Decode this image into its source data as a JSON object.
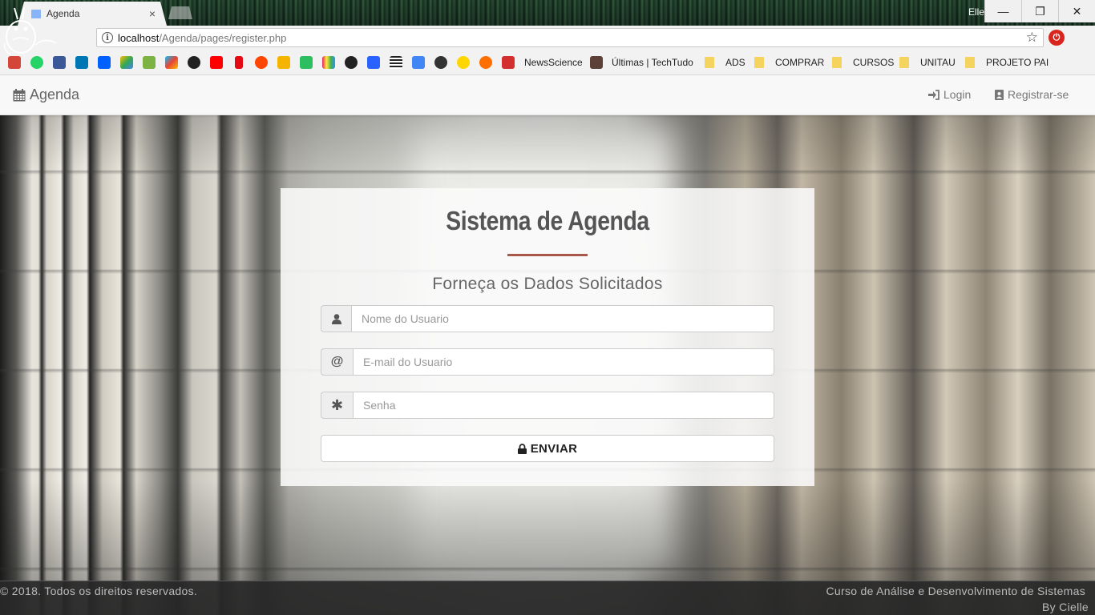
{
  "browser": {
    "tab_title": "Agenda",
    "tab_close": "×",
    "profile_name": "Elle",
    "window_controls": {
      "minimize": "—",
      "restore": "❐",
      "close": "✕"
    },
    "url_host": "localhost",
    "url_path": "/Agenda/pages/register.php",
    "bookmarks": {
      "icons": [
        "gmail-icon",
        "whatsapp-icon",
        "facebook-icon",
        "linkedin-icon",
        "dropbox-icon",
        "google-drive-icon",
        "android-icon",
        "google-play-icon",
        "steam-icon",
        "youtube-icon",
        "netflix-icon",
        "reddit-icon",
        "keep-icon",
        "evernote-icon",
        "colors-icon",
        "chrome-app-icon",
        "calendar-24-icon",
        "news-icon",
        "translate-icon",
        "github-icon",
        "emoji-icon",
        "settings-sun-icon",
        "scribd-icon"
      ],
      "labels": [
        "NewsScience",
        "Últimas | TechTudo",
        "ADS",
        "COMPRAR",
        "CURSOS",
        "UNITAU",
        "PROJETO PAI"
      ]
    }
  },
  "navbar": {
    "brand": "Agenda",
    "login": "Login",
    "register": "Registrar-se"
  },
  "form": {
    "title": "Sistema de Agenda",
    "subtitle": "Forneça os Dados Solicitados",
    "username_placeholder": "Nome do Usuario",
    "email_placeholder": "E-mail do Usuario",
    "email_addon": "@",
    "password_placeholder": "Senha",
    "password_addon": "✱",
    "submit_label": "ENVIAR",
    "accent_color": "#a8574b"
  },
  "footer": {
    "left": "© 2018. Todos os direitos reservados.",
    "right_line1": "Curso de Análise e Desenvolvimento de Sistemas",
    "right_line2": "By Cielle"
  }
}
